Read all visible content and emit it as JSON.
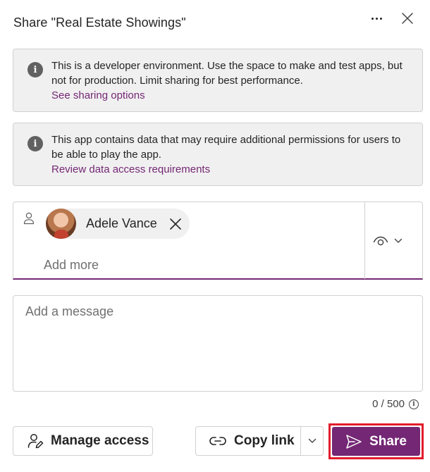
{
  "dialog": {
    "title": "Share \"Real Estate Showings\""
  },
  "notices": [
    {
      "icon": "info-icon",
      "text": "This is a developer environment. Use the space to make and test apps, but not for production. Limit sharing for best performance.",
      "link": "See sharing options"
    },
    {
      "icon": "info-icon",
      "text": "This app contains data that may require additional permissions for users to be able to play the app.",
      "link": "Review data access requirements"
    }
  ],
  "people_picker": {
    "selected": [
      {
        "name": "Adele Vance"
      }
    ],
    "placeholder": "Add more",
    "permission_icon": "eye-icon"
  },
  "message": {
    "placeholder": "Add a message",
    "counter": "0 / 500"
  },
  "actions": {
    "manage_access": "Manage access",
    "copy_link": "Copy link",
    "share": "Share"
  },
  "colors": {
    "accent": "#742774",
    "highlight": "#e21c2b",
    "notice_bg": "#f0f0f0"
  }
}
